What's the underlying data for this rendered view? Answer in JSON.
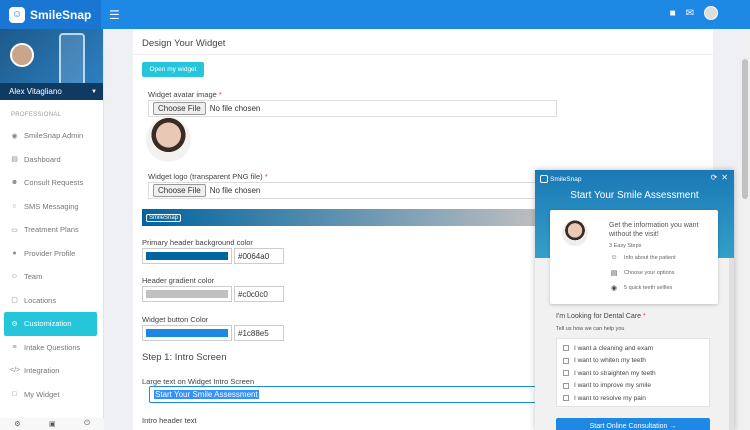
{
  "app": {
    "name": "SmileSnap"
  },
  "topbar": {
    "menu_icon": "hamburger-icon",
    "icons": [
      "chat-icon",
      "mail-icon",
      "user-avatar"
    ]
  },
  "sidebar": {
    "user_name": "Alex Vitagliano",
    "section_label": "PROFESSIONAL",
    "items": [
      {
        "label": "SmileSnap Admin",
        "icon": "user-circle-icon"
      },
      {
        "label": "Dashboard",
        "icon": "chart-icon"
      },
      {
        "label": "Consult Requests",
        "icon": "users-icon"
      },
      {
        "label": "SMS Messaging",
        "icon": "message-icon"
      },
      {
        "label": "Treatment Plans",
        "icon": "folder-icon"
      },
      {
        "label": "Provider Profile",
        "icon": "profile-icon"
      },
      {
        "label": "Team",
        "icon": "team-icon"
      },
      {
        "label": "Locations",
        "icon": "location-icon"
      },
      {
        "label": "Customization",
        "icon": "gear-icon"
      },
      {
        "label": "Intake Questions",
        "icon": "list-icon"
      },
      {
        "label": "Integration",
        "icon": "code-icon"
      },
      {
        "label": "My Widget",
        "icon": "widget-icon"
      }
    ],
    "active_index": 8,
    "footer_icons": [
      "settings-icon",
      "save-icon",
      "power-icon"
    ]
  },
  "main": {
    "section_title": "Design Your Widget",
    "open_widget_button": "Open my widget",
    "avatar_label": "Widget avatar image",
    "logo_label": "Widget logo (transparent PNG file)",
    "required_mark": "*",
    "choose_file": "Choose File",
    "no_file": "No file chosen",
    "preview_logo": "SmileSnap",
    "primary_bg_label": "Primary header background color",
    "primary_bg_value": "#0064a0",
    "gradient_label": "Header gradient color",
    "gradient_value": "#c0c0c0",
    "button_color_label": "Widget button Color",
    "button_color_value": "#1c88e5",
    "step_title": "Step 1: Intro Screen",
    "large_text_label": "Large text on Widget Intro Screen",
    "large_text_value": "Start Your Smile Assessment",
    "intro_header_label": "Intro header text"
  },
  "widget": {
    "logo": "SmileSnap",
    "title": "Start Your Smile Assessment",
    "card_text": "Get the information you want without the visit!",
    "steps_title": "3 Easy Steps",
    "steps": [
      {
        "label": "Info about the patient",
        "icon": "smiley-icon"
      },
      {
        "label": "Choose your options",
        "icon": "clipboard-icon"
      },
      {
        "label": "5 quick teeth selfies",
        "icon": "camera-icon"
      }
    ],
    "looking_label": "I'm Looking for Dental Care",
    "tell_label": "Tell us how we can help you",
    "options": [
      "I want a cleaning and exam",
      "I want to whiten my teeth",
      "I want to straighten my teeth",
      "I want to improve my smile",
      "I want to resolve my pain"
    ],
    "cta": "Start Online Consultation →"
  }
}
